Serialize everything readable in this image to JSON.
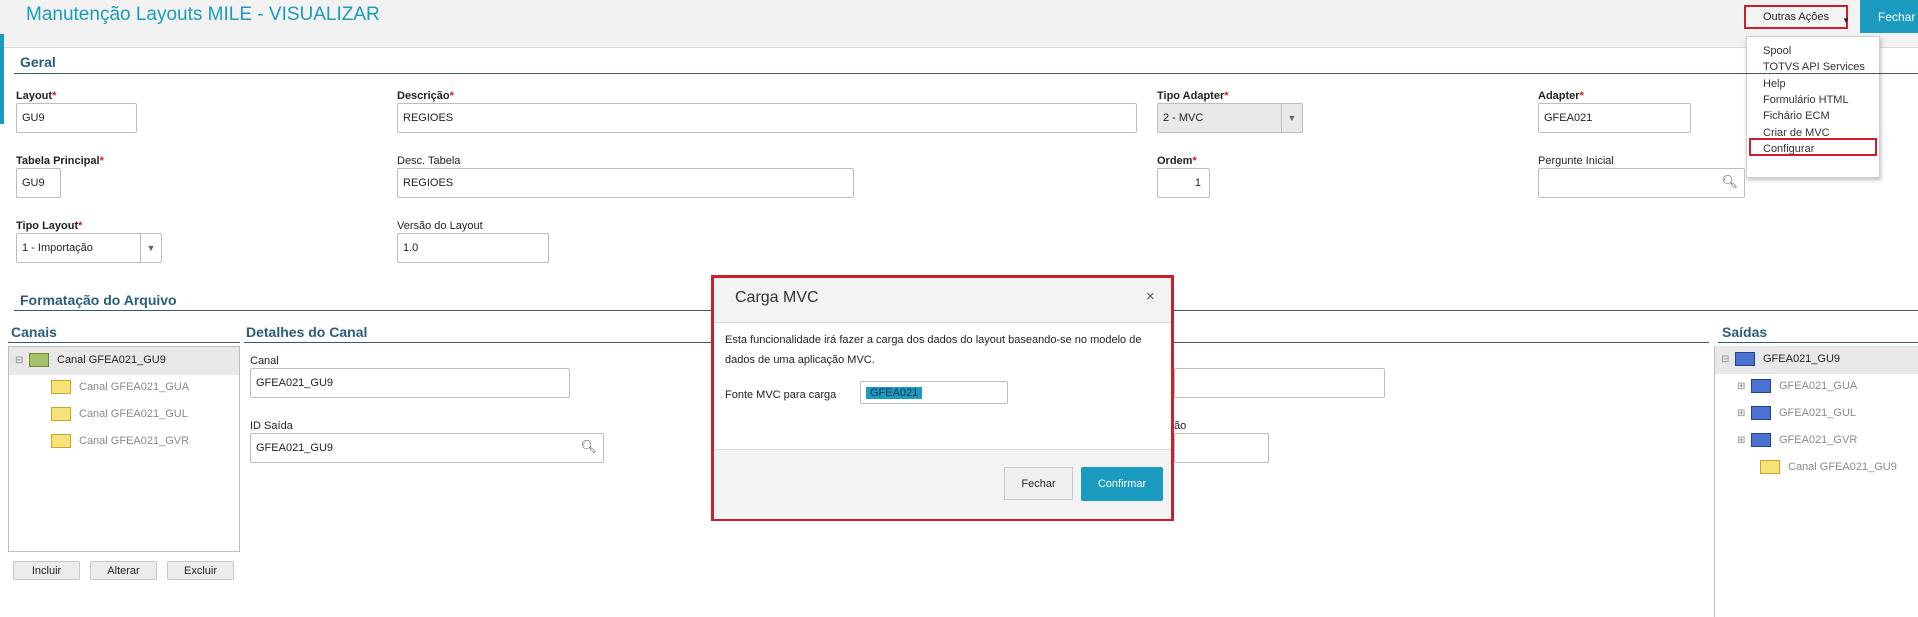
{
  "header": {
    "title": "Manutenção Layouts MILE - VISUALIZAR",
    "outras_acoes": "Outras Ações",
    "fechar": "Fechar"
  },
  "menu": {
    "items": [
      "Spool",
      "TOTVS API Services",
      "Help",
      "Formulário HTML",
      "Fichário ECM",
      "Criar de MVC",
      "Configurar"
    ],
    "highlighted": "Criar de MVC"
  },
  "geral": {
    "section": "Geral",
    "layout_label": "Layout",
    "layout_value": "GU9",
    "descricao_label": "Descrição",
    "descricao_value": "REGIOES",
    "tipo_adapter_label": "Tipo Adapter",
    "tipo_adapter_value": "2 - MVC",
    "adapter_label": "Adapter",
    "adapter_value": "GFEA021",
    "tabela_label": "Tabela Principal",
    "tabela_value": "GU9",
    "desc_tabela_label": "Desc. Tabela",
    "desc_tabela_value": "REGIOES",
    "ordem_label": "Ordem",
    "ordem_value": "1",
    "pergunte_label": "Pergunte Inicial",
    "pergunte_value": "",
    "tipo_layout_label": "Tipo Layout",
    "tipo_layout_value": "1 - Importação",
    "versao_label": "Versão do Layout",
    "versao_value": "1.0",
    "required_mark": "*"
  },
  "formatacao": {
    "section": "Formatação do Arquivo",
    "canais_title": "Canais",
    "detalhes_title": "Detalhes do Canal",
    "saidas_title": "Saídas",
    "canal_label": "Canal",
    "canal_value": "GFEA021_GU9",
    "id_saida_label": "ID Saída",
    "id_saida_value": "GFEA021_GU9",
    "partial_label": "ão"
  },
  "canais_tree": {
    "root": "Canal GFEA021_GU9",
    "children": [
      "Canal GFEA021_GUA",
      "Canal GFEA021_GUL",
      "Canal GFEA021_GVR"
    ]
  },
  "saidas_tree": {
    "root": "GFEA021_GU9",
    "children": [
      "GFEA021_GUA",
      "GFEA021_GUL",
      "GFEA021_GVR",
      "Canal GFEA021_GU9"
    ]
  },
  "buttons": {
    "incluir": "Incluir",
    "alterar": "Alterar",
    "excluir": "Excluir"
  },
  "modal": {
    "title": "Carga MVC",
    "close": "×",
    "text": "Esta funcionalidade irá fazer a carga dos dados do layout baseando-se no modelo de dados de uma aplicação MVC.",
    "fonte_label": "Fonte MVC para carga",
    "fonte_value": "GFEA021",
    "fechar": "Fechar",
    "confirmar": "Confirmar"
  },
  "colors": {
    "accent": "#1a9bbf",
    "highlight_border": "#cc1f2a",
    "section": "#2a5d7a"
  },
  "icons": [
    "search-icon",
    "dropdown-arrow-icon",
    "folder-icon",
    "close-icon",
    "expander-icon"
  ]
}
